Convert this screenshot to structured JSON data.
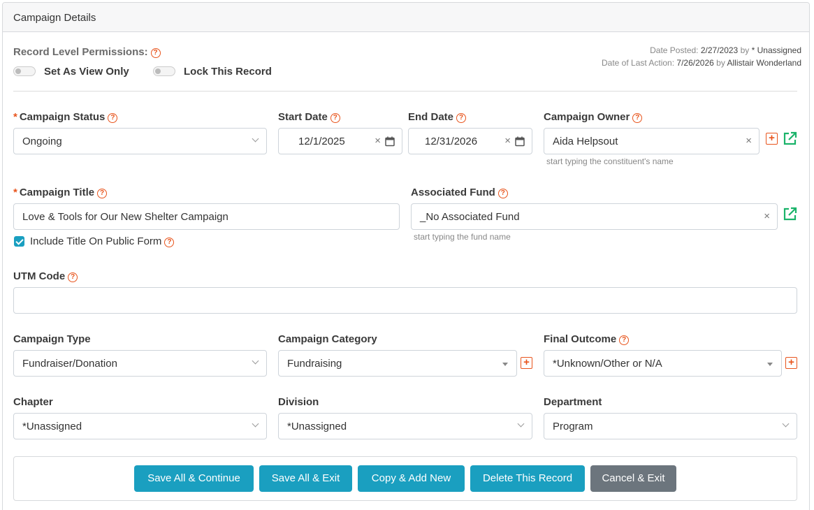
{
  "card": {
    "title": "Campaign Details"
  },
  "permissions": {
    "label": "Record Level Permissions:",
    "view_only": "Set As View Only",
    "lock": "Lock This Record"
  },
  "meta": {
    "posted_label": "Date Posted:",
    "posted_date": "2/27/2023",
    "posted_by_word": "by",
    "posted_by": "* Unassigned",
    "last_action_label": "Date of Last Action:",
    "last_action_date": "7/26/2026",
    "last_action_by_word": "by",
    "last_action_by": "Allistair Wonderland"
  },
  "fields": {
    "status": {
      "label": "Campaign Status",
      "value": "Ongoing"
    },
    "start_date": {
      "label": "Start Date",
      "value": "12/1/2025"
    },
    "end_date": {
      "label": "End Date",
      "value": "12/31/2026"
    },
    "owner": {
      "label": "Campaign Owner",
      "value": "Aida Helpsout",
      "hint": "start typing the constituent's name"
    },
    "title": {
      "label": "Campaign Title",
      "value": "Love & Tools for Our New Shelter Campaign"
    },
    "include_title": {
      "label": "Include Title On Public Form",
      "checked": true
    },
    "fund": {
      "label": "Associated Fund",
      "value": "_No Associated Fund",
      "hint": "start typing the fund name"
    },
    "utm": {
      "label": "UTM Code",
      "value": ""
    },
    "type": {
      "label": "Campaign Type",
      "value": "Fundraiser/Donation"
    },
    "category": {
      "label": "Campaign Category",
      "value": "Fundraising"
    },
    "outcome": {
      "label": "Final Outcome",
      "value": "*Unknown/Other or N/A"
    },
    "chapter": {
      "label": "Chapter",
      "value": "*Unassigned"
    },
    "division": {
      "label": "Division",
      "value": "*Unassigned"
    },
    "department": {
      "label": "Department",
      "value": "Program"
    }
  },
  "buttons": {
    "save_continue": "Save All & Continue",
    "save_exit": "Save All & Exit",
    "copy_add": "Copy & Add New",
    "delete": "Delete This Record",
    "cancel": "Cancel & Exit"
  },
  "glyphs": {
    "required": "*",
    "help": "?",
    "clear": "×",
    "plus": "+"
  },
  "icons": [
    "help-icon",
    "calendar-icon",
    "chevron-down-icon",
    "clear-icon",
    "add-icon",
    "external-link-icon",
    "check-icon"
  ],
  "colors": {
    "accent": "#1a9fc0",
    "required": "#e8541c",
    "link_icon": "#1ab36a",
    "cancel": "#6c757d"
  }
}
